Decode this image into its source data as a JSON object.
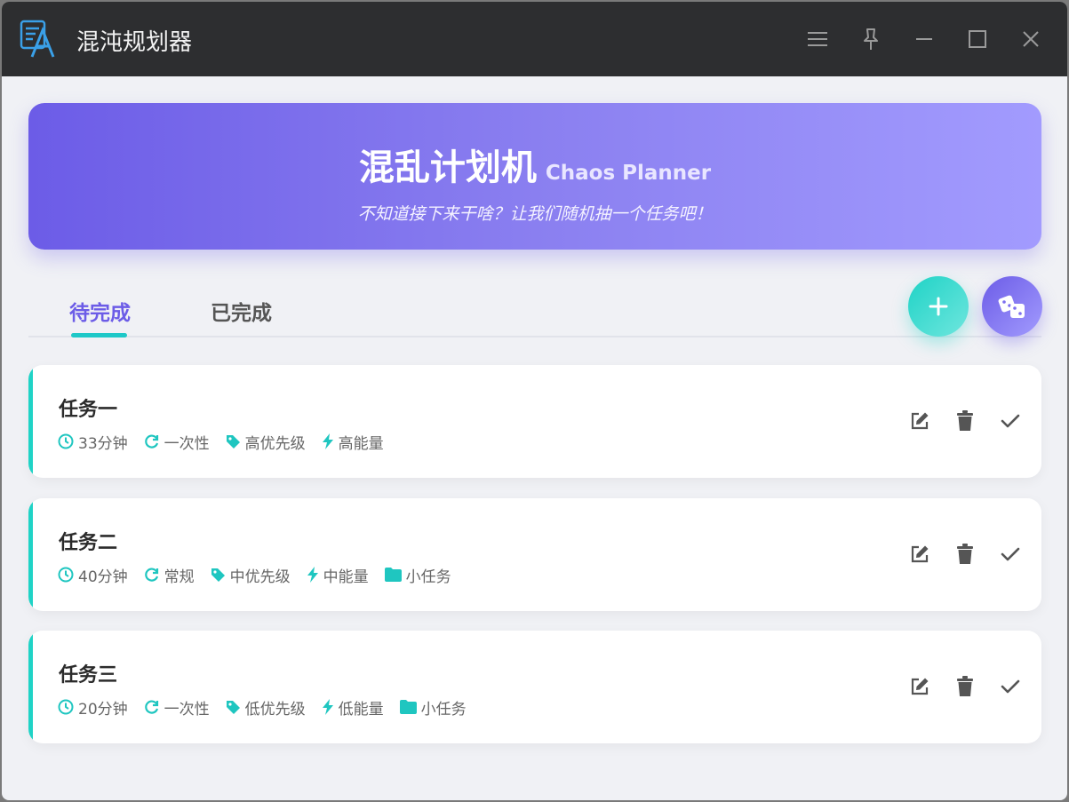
{
  "window": {
    "title": "混沌规划器"
  },
  "hero": {
    "title": "混乱计划机",
    "subtitle_en": "Chaos Planner",
    "tagline": "不知道接下来干啥？让我们随机抽一个任务吧！"
  },
  "tabs": [
    {
      "label": "待完成",
      "active": true
    },
    {
      "label": "已完成",
      "active": false
    }
  ],
  "colors": {
    "accent": "#6c5ce7",
    "teal": "#1fd3c6",
    "titlebar": "#2d2e30"
  },
  "tasks": [
    {
      "title": "任务一",
      "duration": "33分钟",
      "type": "一次性",
      "priority": "高优先级",
      "energy": "高能量",
      "folder": ""
    },
    {
      "title": "任务二",
      "duration": "40分钟",
      "type": "常规",
      "priority": "中优先级",
      "energy": "中能量",
      "folder": "小任务"
    },
    {
      "title": "任务三",
      "duration": "20分钟",
      "type": "一次性",
      "priority": "低优先级",
      "energy": "低能量",
      "folder": "小任务"
    }
  ]
}
